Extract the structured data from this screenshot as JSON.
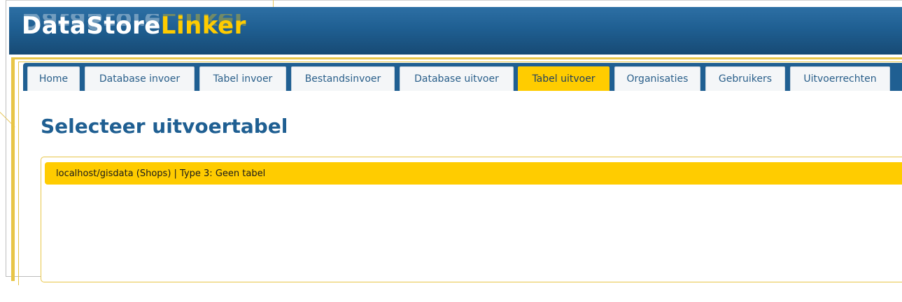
{
  "app": {
    "logo_part1": "DataStore",
    "logo_part2": "Linker"
  },
  "nav": {
    "tabs": [
      {
        "label": "Home",
        "active": false
      },
      {
        "label": "Database invoer",
        "active": false
      },
      {
        "label": "Tabel invoer",
        "active": false
      },
      {
        "label": "Bestandsinvoer",
        "active": false
      },
      {
        "label": "Database uitvoer",
        "active": false
      },
      {
        "label": "Tabel uitvoer",
        "active": true
      },
      {
        "label": "Organisaties",
        "active": false
      },
      {
        "label": "Gebruikers",
        "active": false
      },
      {
        "label": "Uitvoerrechten",
        "active": false
      }
    ]
  },
  "main": {
    "title": "Selecteer uitvoertabel",
    "tables": [
      {
        "label": "localhost/gisdata (Shops) | Type 3: Geen tabel"
      }
    ]
  },
  "colors": {
    "brand_blue": "#1f5f92",
    "accent_gold": "#ffcc00",
    "frame_gold": "#e8c547"
  }
}
